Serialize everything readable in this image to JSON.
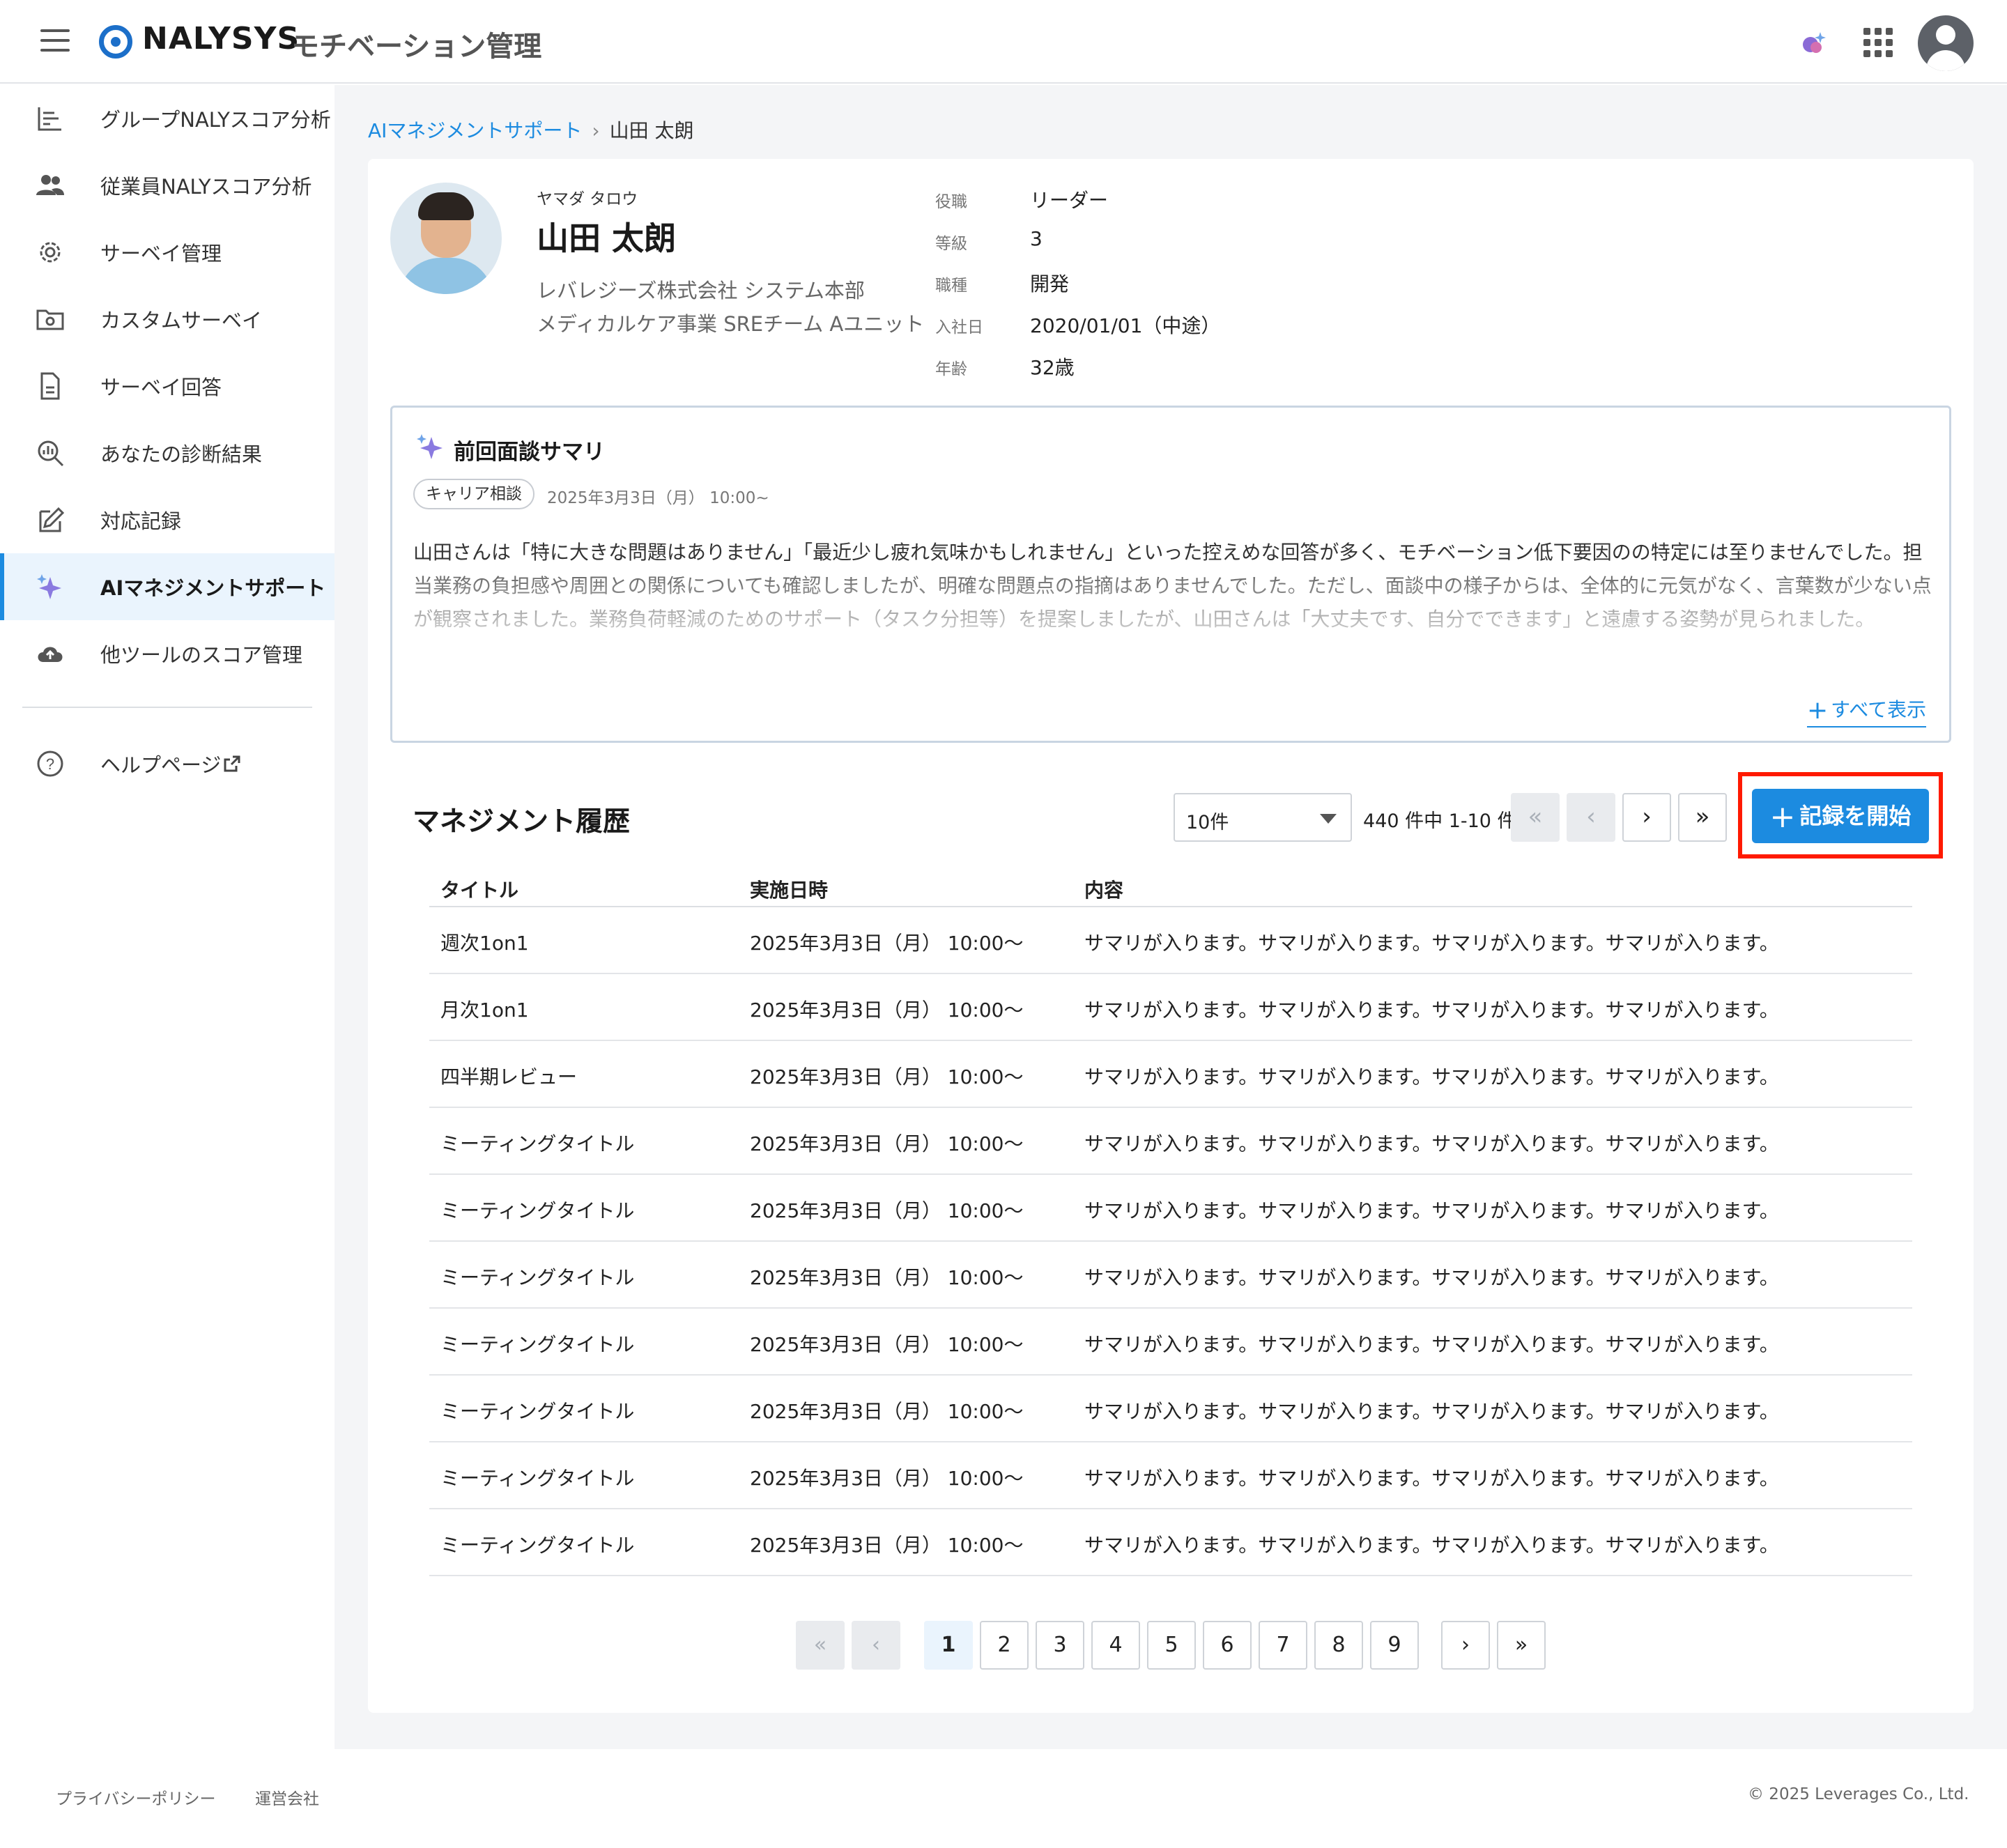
{
  "header": {
    "logo_text": "NALYSYS",
    "app_name": "モチベーション管理"
  },
  "sidebar": {
    "items": [
      {
        "label": "グループNALYスコア分析",
        "icon": "bar-chart-icon"
      },
      {
        "label": "従業員NALYスコア分析",
        "icon": "people-icon"
      },
      {
        "label": "サーベイ管理",
        "icon": "gear-icon"
      },
      {
        "label": "カスタムサーベイ",
        "icon": "folder-gear-icon"
      },
      {
        "label": "サーベイ回答",
        "icon": "document-icon"
      },
      {
        "label": "あなたの診断結果",
        "icon": "magnifier-chart-icon"
      },
      {
        "label": "対応記録",
        "icon": "edit-icon"
      },
      {
        "label": "AIマネジメントサポート",
        "icon": "sparkle-icon",
        "active": true
      },
      {
        "label": "他ツールのスコア管理",
        "icon": "cloud-upload-icon"
      }
    ],
    "help": {
      "label": "ヘルプページ",
      "icon": "help-icon"
    }
  },
  "breadcrumb": {
    "parent": "AIマネジメントサポート",
    "current": "山田 太朗"
  },
  "profile": {
    "kana": "ヤマダ タロウ",
    "name": "山田 太朗",
    "org_line1": "レバレジーズ株式会社 システム本部",
    "org_line2": "メディカルケア事業 SREチーム Aユニット",
    "attributes": [
      {
        "label": "役職",
        "value": "リーダー"
      },
      {
        "label": "等級",
        "value": "3"
      },
      {
        "label": "職種",
        "value": "開発"
      },
      {
        "label": "入社日",
        "value": "2020/01/01（中途）"
      },
      {
        "label": "年齢",
        "value": "32歳"
      }
    ]
  },
  "summary": {
    "title": "前回面談サマリ",
    "tag": "キャリア相談",
    "date": "2025年3月3日（月） 10:00~",
    "text": "山田さんは「特に大きな問題はありません」「最近少し疲れ気味かもしれません」といった控えめな回答が多く、モチベーション低下要因のの特定には至りませんでした。担当業務の負担感や周囲との関係についても確認しましたが、明確な問題点の指摘はありませんでした。ただし、面談中の様子からは、全体的に元気がなく、言葉数が少ない点が観察されました。業務負荷軽減のためのサポート（タスク分担等）を提案しましたが、山田さんは「大丈夫です、自分でできます」と遠慮する姿勢が見られました。",
    "show_all": "すべて表示"
  },
  "history": {
    "title": "マネジメント履歴",
    "per_page": "10件",
    "range": "440 件中 1-10 件",
    "start_button": "記録を開始",
    "columns": [
      "タイトル",
      "実施日時",
      "内容"
    ],
    "rows": [
      {
        "title": "週次1on1",
        "datetime": "2025年3月3日（月） 10:00〜",
        "content": "サマリが入ります。サマリが入ります。サマリが入ります。サマリが入ります。"
      },
      {
        "title": "月次1on1",
        "datetime": "2025年3月3日（月） 10:00〜",
        "content": "サマリが入ります。サマリが入ります。サマリが入ります。サマリが入ります。"
      },
      {
        "title": "四半期レビュー",
        "datetime": "2025年3月3日（月） 10:00〜",
        "content": "サマリが入ります。サマリが入ります。サマリが入ります。サマリが入ります。"
      },
      {
        "title": "ミーティングタイトル",
        "datetime": "2025年3月3日（月） 10:00〜",
        "content": "サマリが入ります。サマリが入ります。サマリが入ります。サマリが入ります。"
      },
      {
        "title": "ミーティングタイトル",
        "datetime": "2025年3月3日（月） 10:00〜",
        "content": "サマリが入ります。サマリが入ります。サマリが入ります。サマリが入ります。"
      },
      {
        "title": "ミーティングタイトル",
        "datetime": "2025年3月3日（月） 10:00〜",
        "content": "サマリが入ります。サマリが入ります。サマリが入ります。サマリが入ります。"
      },
      {
        "title": "ミーティングタイトル",
        "datetime": "2025年3月3日（月） 10:00〜",
        "content": "サマリが入ります。サマリが入ります。サマリが入ります。サマリが入ります。"
      },
      {
        "title": "ミーティングタイトル",
        "datetime": "2025年3月3日（月） 10:00〜",
        "content": "サマリが入ります。サマリが入ります。サマリが入ります。サマリが入ります。"
      },
      {
        "title": "ミーティングタイトル",
        "datetime": "2025年3月3日（月） 10:00〜",
        "content": "サマリが入ります。サマリが入ります。サマリが入ります。サマリが入ります。"
      },
      {
        "title": "ミーティングタイトル",
        "datetime": "2025年3月3日（月） 10:00〜",
        "content": "サマリが入ります。サマリが入ります。サマリが入ります。サマリが入ります。"
      }
    ]
  },
  "pagination": {
    "pages": [
      "1",
      "2",
      "3",
      "4",
      "5",
      "6",
      "7",
      "8",
      "9"
    ],
    "current": "1",
    "first": "«",
    "prev": "‹",
    "next": "›",
    "last": "»"
  },
  "footer": {
    "privacy": "プライバシーポリシー",
    "company": "運営会社",
    "copyright": "© 2025 Leverages Co., Ltd."
  },
  "colors": {
    "accent": "#1c8be0",
    "highlight_border": "#ff1a00",
    "logo": "#1c6fc9"
  }
}
